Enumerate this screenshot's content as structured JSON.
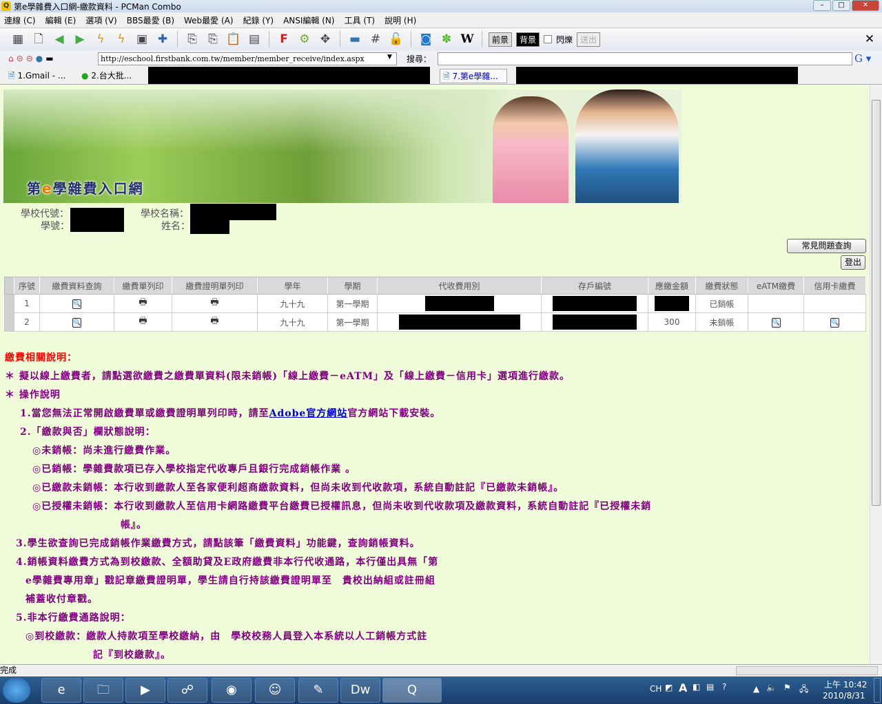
{
  "window": {
    "title": "第e學雜費入口網-繳款資料 - PCMan Combo"
  },
  "menu": [
    "連線 (C)",
    "編輯 (E)",
    "選項 (V)",
    "BBS最愛 (B)",
    "Web最愛 (A)",
    "紀錄 (Y)",
    "ANSI編輯 (N)",
    "工具 (T)",
    "說明 (H)"
  ],
  "toolbar": {
    "fg": "前景",
    "bg": "背景",
    "blink": "閃爍",
    "send": "送出"
  },
  "address": {
    "url": "http://eschool.firstbank.com.tw/member/member_receive/index.aspx",
    "search_label": "搜尋："
  },
  "tabs": [
    "1.Gmail - ...",
    "2.台大批...",
    "7.第e學雜..."
  ],
  "banner": {
    "logo_pre": "第",
    "logo_e": "e",
    "logo_post": "學雜費入口網"
  },
  "info": {
    "school_code": "學校代號：",
    "student_id": "學號：",
    "school_name": "學校名稱：",
    "name": "姓名："
  },
  "buttons": {
    "faq": "常見問題查詢",
    "logout": "登出"
  },
  "table": {
    "headers": [
      "序號",
      "繳費資料查詢",
      "繳費單列印",
      "繳費證明單列印",
      "學年",
      "學期",
      "代收費用別",
      "存戶編號",
      "應繳金額",
      "繳費狀態",
      "eATM繳費",
      "信用卡繳費"
    ],
    "rows": [
      {
        "no": "1",
        "year": "九十九",
        "term": "第一學期",
        "amount": "",
        "status": "已銷帳"
      },
      {
        "no": "2",
        "year": "九十九",
        "term": "第一學期",
        "amount": "300",
        "status": "未銷帳"
      }
    ]
  },
  "notes": {
    "title": "繳費相關說明：",
    "l1": "＊ 擬以線上繳費者，請點選欲繳費之繳費單資料(限未銷帳)「線上繳費－eATM」及「線上繳費－信用卡」選項進行繳款。",
    "l2": "＊ 操作說明",
    "l3a": "1.當您無法正常開啟繳費單或繳費證明單列印時，請至",
    "l3link": "Adobe官方網站",
    "l3b": "官方網站下載安裝。",
    "l4": "2.「繳款與否」欄狀態說明：",
    "l5": "◎未銷帳：尚未進行繳費作業。",
    "l6": "◎已銷帳：學雜費款項已存入學校指定代收專戶且銀行完成銷帳作業 。",
    "l7": "◎已繳款未銷帳：本行收到繳款人至各家便利超商繳款資料，但尚未收到代收款項，系統自動註記『已繳款未銷帳』。",
    "l8": "◎已授權未銷帳：本行收到繳款人至信用卡網路繳費平台繳費已授權訊息，但尚未收到代收款項及繳款資料，系統自動註記『已授權未銷",
    "l8b": "帳』。",
    "l9": "3.學生欲查詢已完成銷帳作業繳費方式，請點該筆「繳費資料」功能鍵，查詢銷帳資料。",
    "l10": "4.銷帳資料繳費方式為到校繳款、全額助貸及E政府繳費非本行代收通路，本行僅出具無「第",
    "l10b": "e學雜費專用章」戳記章繳費證明單，學生請自行持該繳費證明單至　貴校出納組或註冊組",
    "l10c": "補蓋收付章戳。",
    "l11": "5.非本行繳費通路說明：",
    "l12": "◎到校繳款：繳款人持款項至學校繳納，由　學校校務人員登入本系統以人工銷帳方式註",
    "l12b": "記『到校繳款』。"
  },
  "status": "完成",
  "taskbar": {
    "lang": "CH",
    "time": "上午 10:42",
    "date": "2010/8/31"
  }
}
